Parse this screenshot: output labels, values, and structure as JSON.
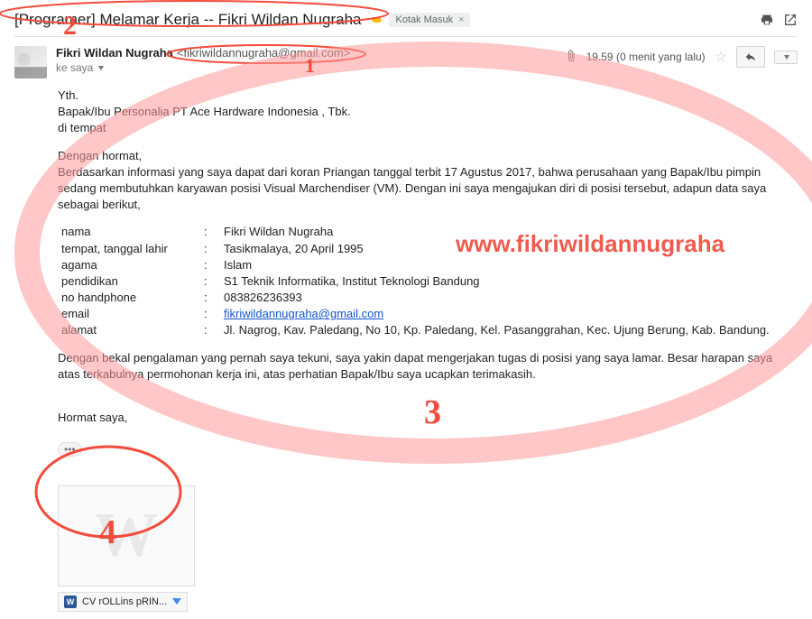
{
  "subject": "[Programer] Melamar Kerja -- Fikri Wildan Nugraha",
  "inbox_chip": "Kotak Masuk",
  "sender": {
    "name": "Fikri Wildan Nugraha",
    "email": "<fikriwildannugraha@gmail.com>",
    "to_label": "ke saya"
  },
  "meta": {
    "time": "19.59 (0 menit yang lalu)",
    "attachment_icon": "paperclip-icon"
  },
  "body": {
    "greeting": "Yth.",
    "addr1": "Bapak/Ibu Personalia PT Ace Hardware Indonesia , Tbk.",
    "addr2": "di tempat",
    "open": "Dengan hormat,",
    "para1": "Berdasarkan informasi yang saya dapat dari koran Priangan tanggal terbit 17 Agustus 2017, bahwa perusahaan yang Bapak/Ibu pimpin sedang membutuhkan karyawan posisi Visual Marchendiser (VM). Dengan ini saya mengajukan diri di posisi tersebut, adapun data saya sebagai berikut,",
    "fields": [
      {
        "label": "nama",
        "value": "Fikri Wildan Nugraha"
      },
      {
        "label": "tempat, tanggal lahir",
        "value": "Tasikmalaya, 20  April 1995"
      },
      {
        "label": "agama",
        "value": "Islam"
      },
      {
        "label": "pendidikan",
        "value": "S1 Teknik Informatika, Institut Teknologi Bandung"
      },
      {
        "label": "no handphone",
        "value": "083826236393"
      },
      {
        "label": "email",
        "value": "fikriwildannugraha@gmail.com",
        "is_link": true
      },
      {
        "label": "alamat",
        "value": "Jl. Nagrog, Kav. Paledang, No 10, Kp. Paledang, Kel. Pasanggrahan, Kec. Ujung Berung, Kab. Bandung."
      }
    ],
    "para2": "Dengan bekal pengalaman yang pernah saya tekuni, saya yakin dapat mengerjakan tugas di posisi yang saya lamar. Besar harapan saya atas terkabulnya permohonan kerja ini, atas perhatian Bapak/Ibu saya ucapkan terimakasih.",
    "signoff": "Hormat saya,"
  },
  "attachment": {
    "filename": "CV rOLLins pRIN..."
  },
  "annotations": {
    "num1": "1",
    "num2": "2",
    "num3": "3",
    "num4": "4",
    "watermark": "www.fikriwildannugraha"
  },
  "colors": {
    "annotation": "#f44b3a",
    "link": "#1155cc"
  }
}
